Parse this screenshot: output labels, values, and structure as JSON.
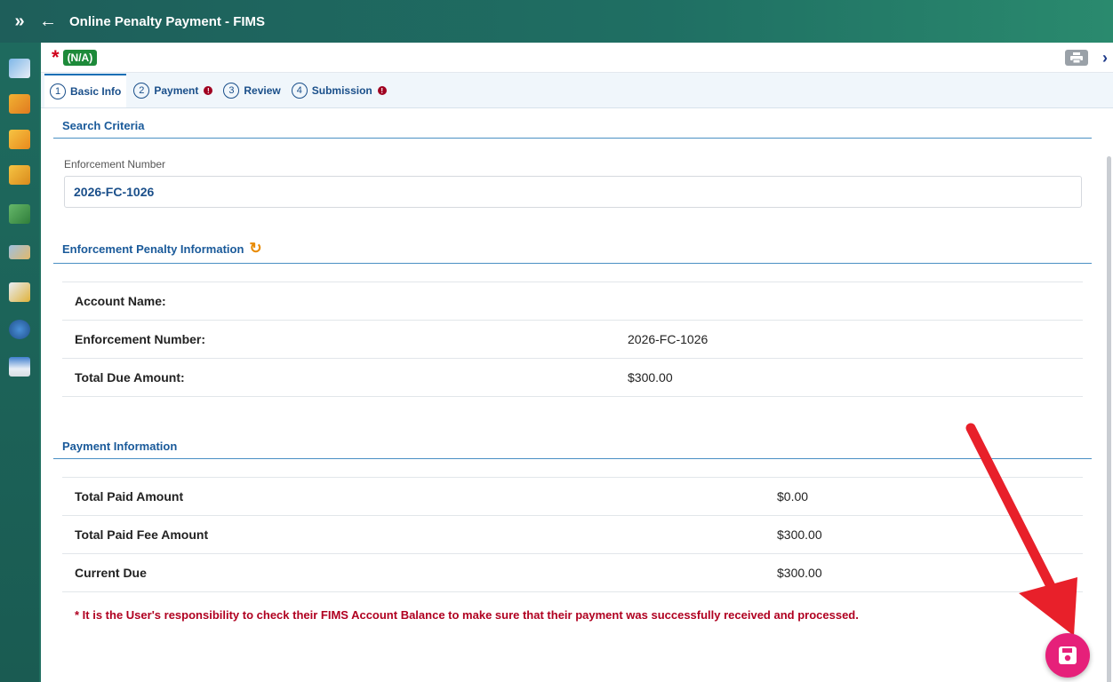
{
  "header": {
    "expand_icon": "double-chevron-right-icon",
    "back_icon": "arrow-left-icon",
    "title": "Online Penalty Payment - FIMS"
  },
  "status": {
    "required_mark": "*",
    "badge": "(N/A)"
  },
  "tabs": [
    {
      "num": "1",
      "label": "Basic Info",
      "alert": false
    },
    {
      "num": "2",
      "label": "Payment",
      "alert": true
    },
    {
      "num": "3",
      "label": "Review",
      "alert": false
    },
    {
      "num": "4",
      "label": "Submission",
      "alert": true
    }
  ],
  "search": {
    "heading": "Search Criteria",
    "field_label": "Enforcement Number",
    "field_value": "2026-FC-1026"
  },
  "penalty": {
    "heading": "Enforcement Penalty Information",
    "rows": [
      {
        "label": "Account Name:",
        "value": ""
      },
      {
        "label": "Enforcement Number:",
        "value": "2026-FC-1026"
      },
      {
        "label": "Total Due Amount:",
        "value": "$300.00"
      }
    ]
  },
  "payment": {
    "heading": "Payment Information",
    "rows": [
      {
        "label": "Total Paid Amount",
        "value": "$0.00"
      },
      {
        "label": "Total Paid Fee Amount",
        "value": "$300.00"
      },
      {
        "label": "Current Due",
        "value": "$300.00"
      }
    ]
  },
  "notice": "* It is the User's responsibility to check their FIMS Account Balance to make sure that their payment was successfully received and processed.",
  "colors": {
    "accent": "#1a5a9a",
    "save_button": "#e6207a",
    "arrow": "#e8202a",
    "notice": "#b00020"
  }
}
